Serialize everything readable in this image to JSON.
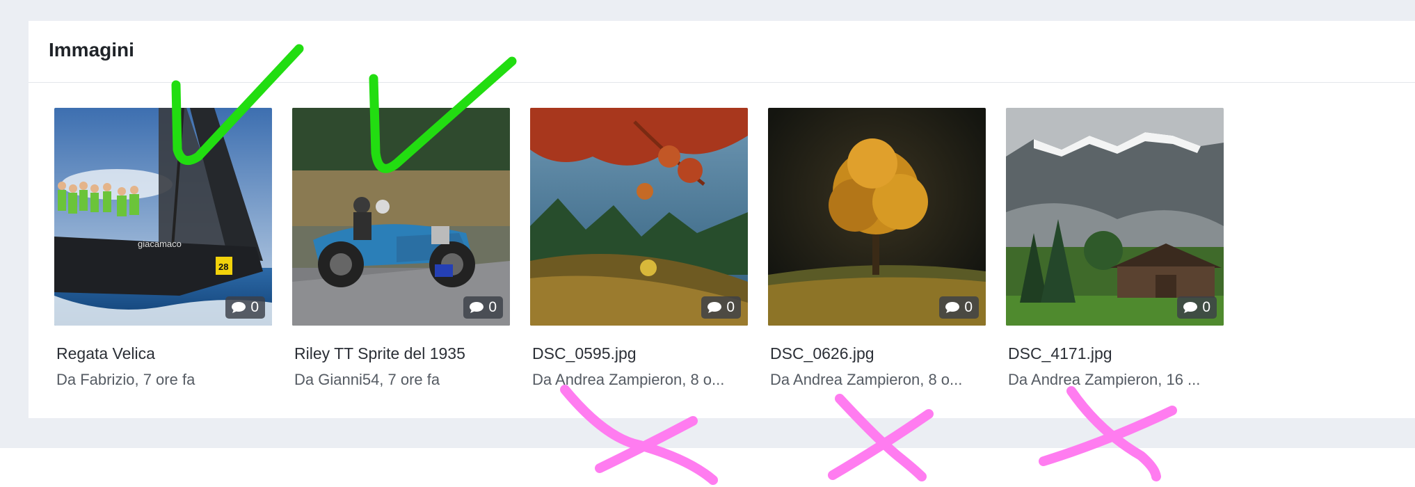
{
  "card": {
    "title": "Immagini"
  },
  "images": [
    {
      "title": "Regata Velica",
      "meta": "Da Fabrizio, 7 ore fa",
      "comments": "0",
      "icon": "comment-icon",
      "approved": true
    },
    {
      "title": "Riley TT Sprite del 1935",
      "meta": "Da Gianni54, 7 ore fa",
      "comments": "0",
      "icon": "comment-icon",
      "approved": true
    },
    {
      "title": "DSC_0595.jpg",
      "meta": "Da Andrea Zampieron, 8 o...",
      "comments": "0",
      "icon": "comment-icon",
      "approved": false
    },
    {
      "title": "DSC_0626.jpg",
      "meta": "Da Andrea Zampieron, 8 o...",
      "comments": "0",
      "icon": "comment-icon",
      "approved": false
    },
    {
      "title": "DSC_4171.jpg",
      "meta": "Da Andrea Zampieron, 16 ...",
      "comments": "0",
      "icon": "comment-icon",
      "approved": false
    }
  ],
  "colors": {
    "page_background": "#ebeef3",
    "check_mark": "#22dd11",
    "cross_mark": "#ff7cf0"
  }
}
